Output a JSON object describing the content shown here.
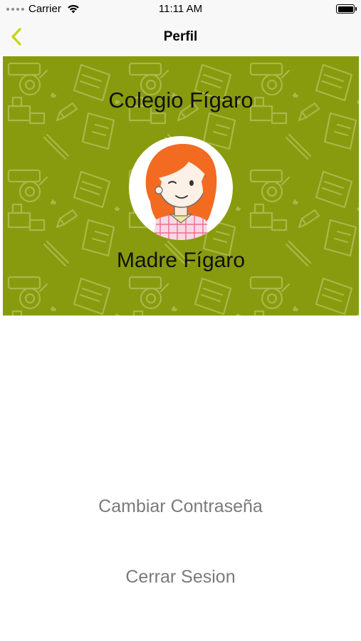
{
  "status_bar": {
    "carrier": "Carrier",
    "time": "11:11 AM"
  },
  "nav": {
    "title": "Perfil",
    "back_icon": "chevron-left-icon",
    "accent_color": "#c6d400"
  },
  "profile": {
    "school_name": "Colegio Fígaro",
    "user_name": "Madre Fígaro",
    "avatar_icon": "girl-avatar",
    "header_color": "#889b0e"
  },
  "actions": {
    "change_password": "Cambiar Contraseña",
    "logout": "Cerrar Sesion"
  }
}
